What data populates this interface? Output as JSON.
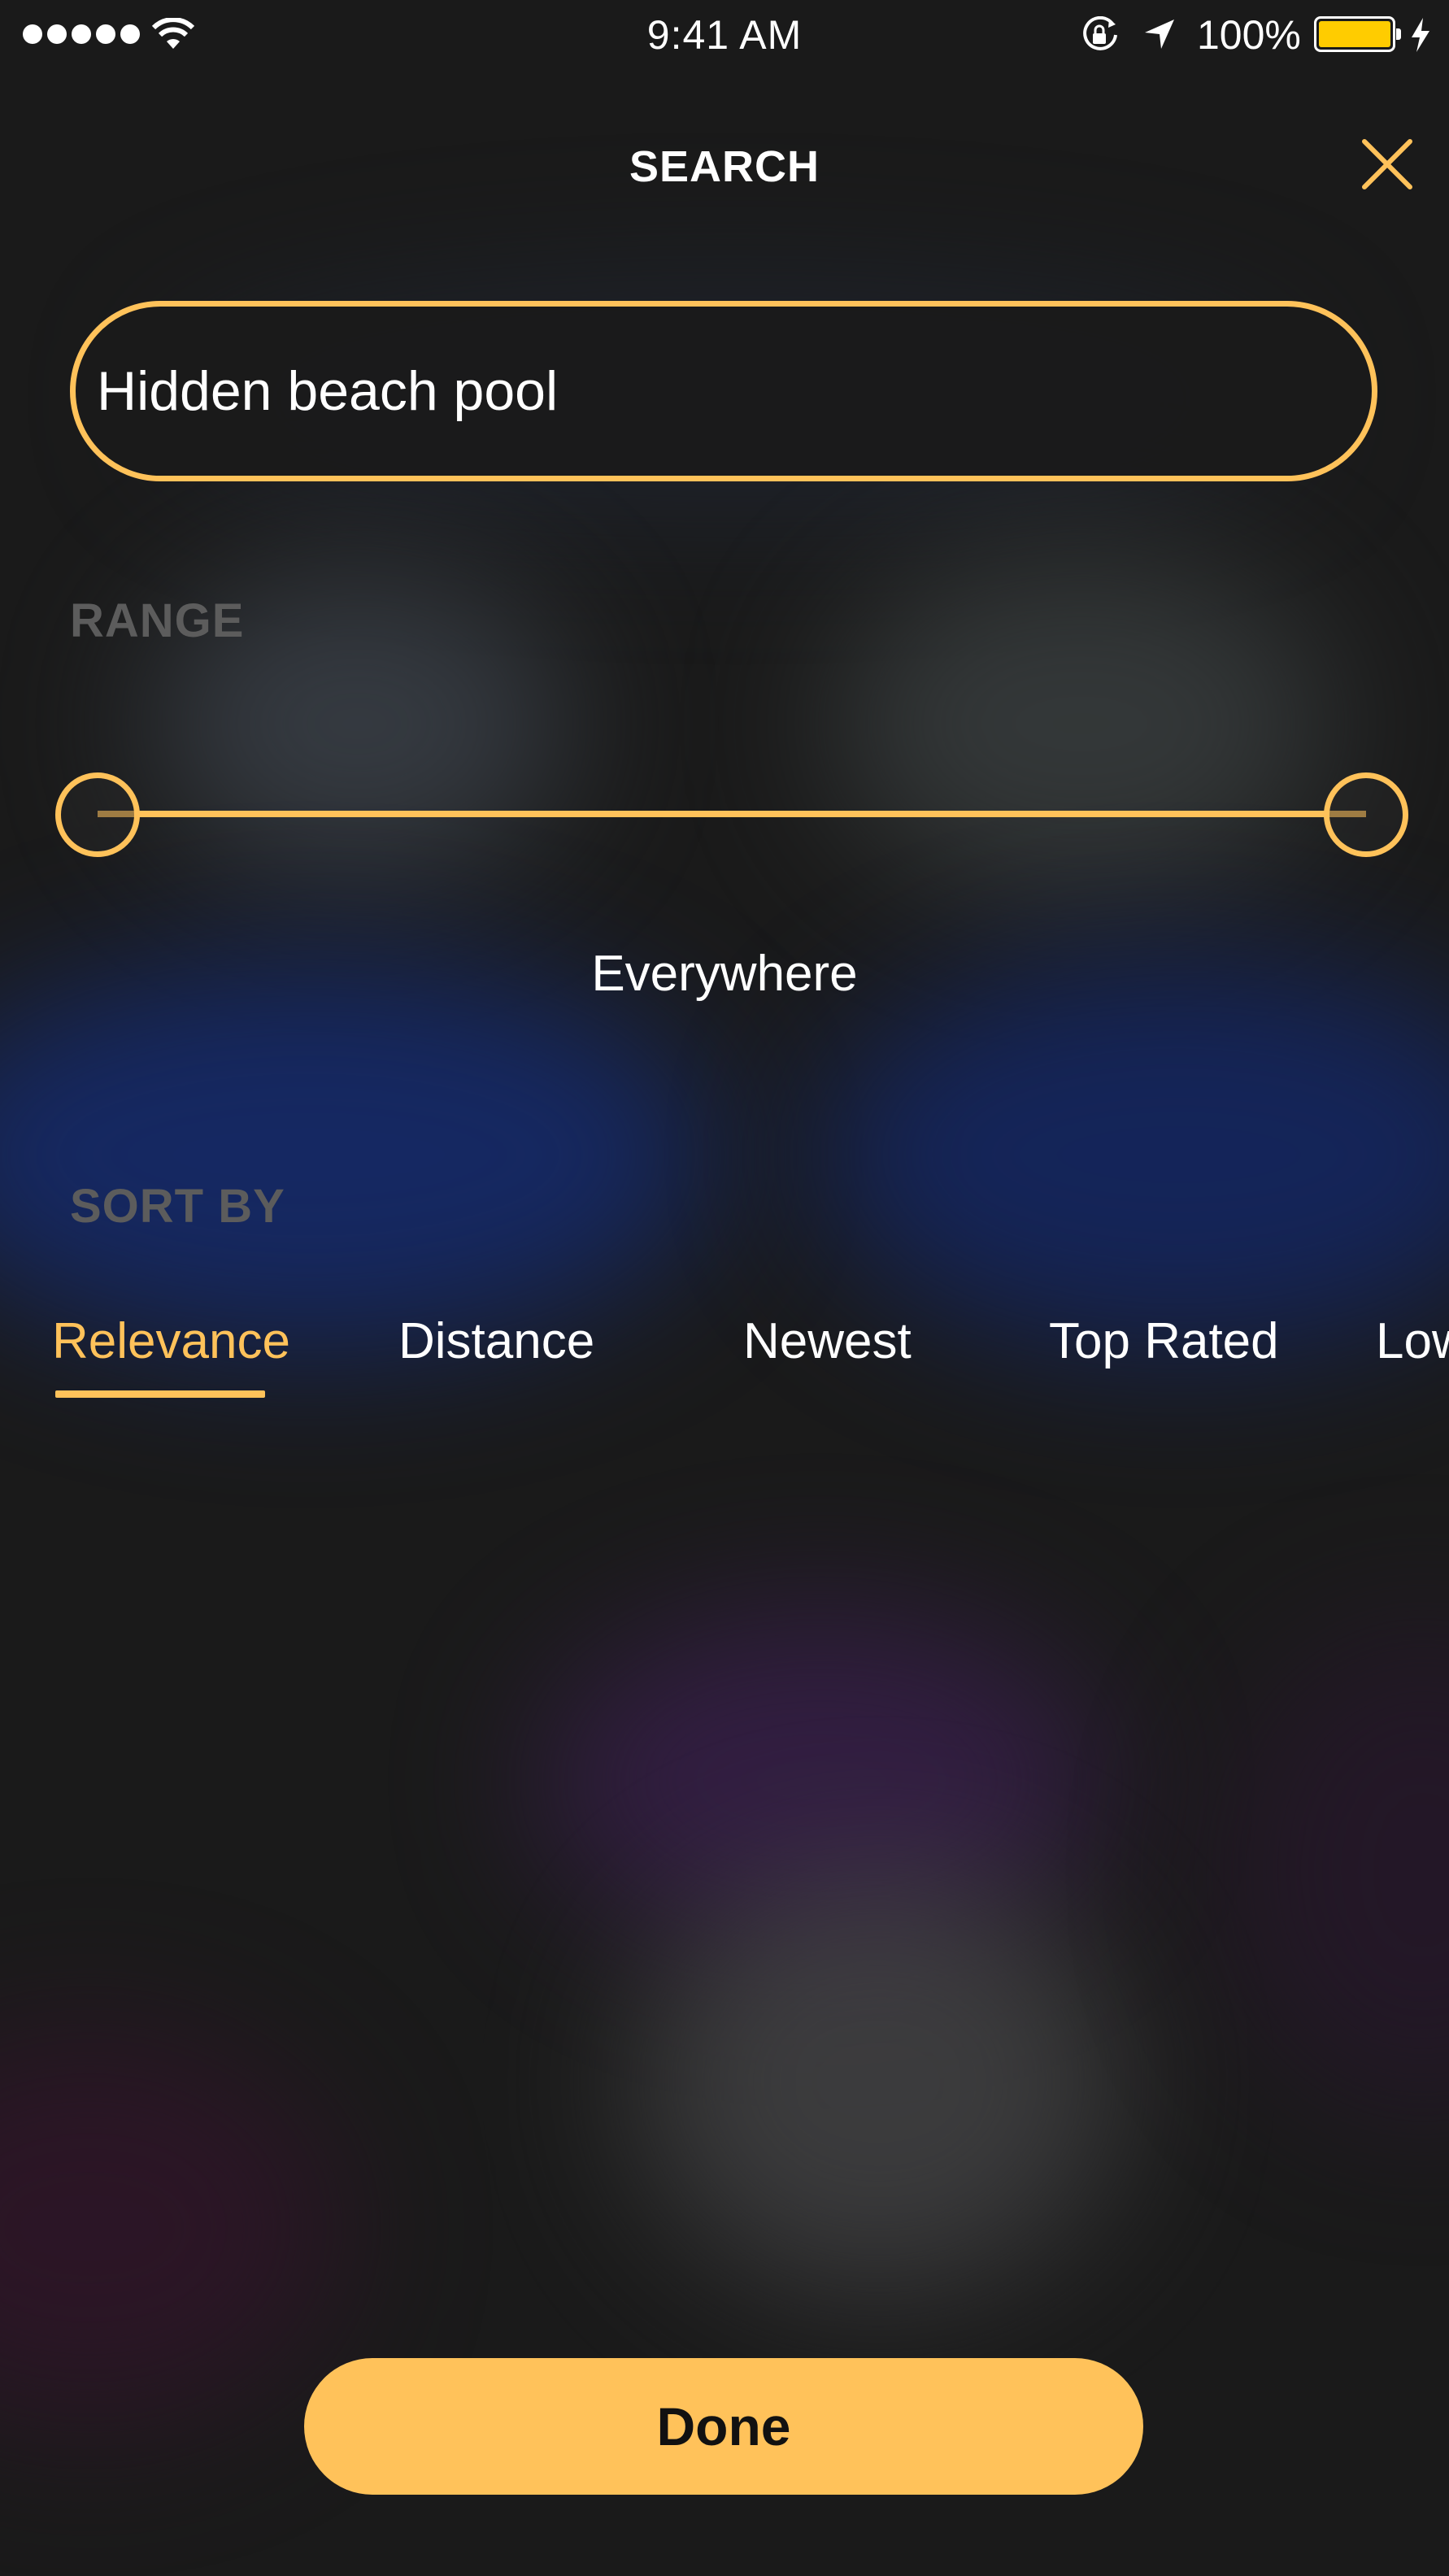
{
  "status_bar": {
    "time": "9:41 AM",
    "battery_percent": "100%",
    "signal_bars": 5,
    "battery_level": 1.0,
    "icons": [
      "signal-dots-icon",
      "wifi-icon",
      "rotation-lock-icon",
      "location-arrow-icon",
      "battery-icon",
      "charging-bolt-icon"
    ]
  },
  "header": {
    "title": "SEARCH",
    "close_icon": "close-icon"
  },
  "search": {
    "value": "Hidden beach pool"
  },
  "range": {
    "label": "RANGE",
    "value_text": "Everywhere",
    "min_fraction": 0.0,
    "max_fraction": 1.0
  },
  "sort": {
    "label": "SORT BY",
    "options": [
      "Relevance",
      "Distance",
      "Newest",
      "Top Rated",
      "Lowest Price"
    ],
    "selected": "Relevance"
  },
  "done_label": "Done",
  "colors": {
    "accent": "#ffc25a",
    "background": "#1a1a1a",
    "section_label": "#5c5c5c",
    "text": "#ffffff"
  }
}
